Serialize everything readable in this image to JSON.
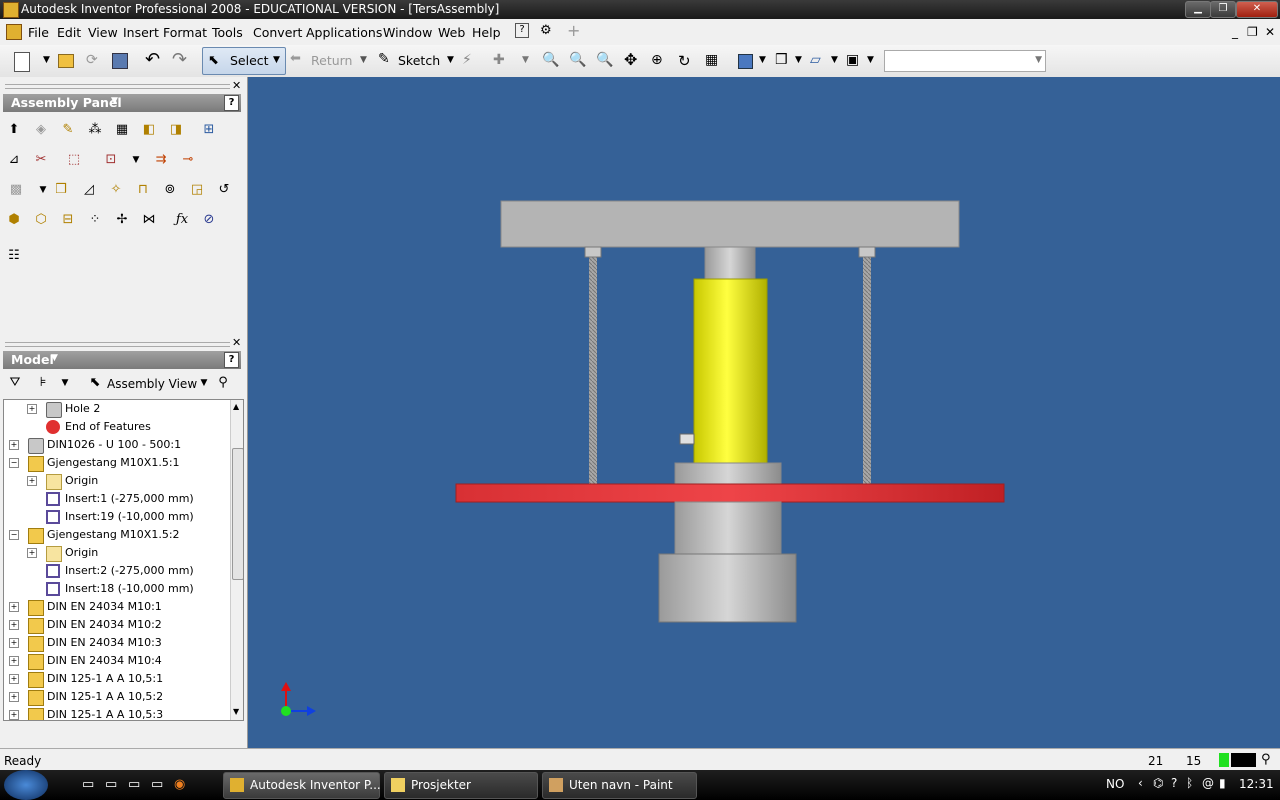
{
  "window": {
    "title": "Autodesk Inventor Professional 2008 - EDUCATIONAL VERSION - [TersAssembly]",
    "min_label": "▁",
    "max_label": "❐",
    "close_label": "✕"
  },
  "menu": {
    "items": [
      "File",
      "Edit",
      "View",
      "Insert",
      "Format",
      "Tools",
      "Convert",
      "Applications",
      "Window",
      "Web",
      "Help"
    ],
    "mdi_min": "_",
    "mdi_restore": "❐",
    "mdi_close": "✕"
  },
  "toolbar": {
    "select_label": "Select",
    "return_label": "Return",
    "sketch_label": "Sketch",
    "combo_value": ""
  },
  "assembly_panel": {
    "title": "Assembly Panel",
    "help": "?"
  },
  "model_panel": {
    "title": "Model",
    "help": "?",
    "view_label": "Assembly View",
    "tree": [
      {
        "label": "Hole 2",
        "icon": "hole",
        "depth": 1,
        "expand": "+"
      },
      {
        "label": "End of Features",
        "icon": "end",
        "depth": 1,
        "expand": ""
      },
      {
        "label": "DIN1026 - U 100 - 500:1",
        "icon": "hole",
        "depth": 0,
        "expand": "+"
      },
      {
        "label": "Gjengestang M10X1.5:1",
        "icon": "asm",
        "depth": 0,
        "expand": "−"
      },
      {
        "label": "Origin",
        "icon": "folder",
        "depth": 1,
        "expand": "+"
      },
      {
        "label": "Insert:1 (-275,000 mm)",
        "icon": "insert",
        "depth": 1,
        "expand": ""
      },
      {
        "label": "Insert:19 (-10,000 mm)",
        "icon": "insert",
        "depth": 1,
        "expand": ""
      },
      {
        "label": "Gjengestang M10X1.5:2",
        "icon": "asm",
        "depth": 0,
        "expand": "−"
      },
      {
        "label": "Origin",
        "icon": "folder",
        "depth": 1,
        "expand": "+"
      },
      {
        "label": "Insert:2 (-275,000 mm)",
        "icon": "insert",
        "depth": 1,
        "expand": ""
      },
      {
        "label": "Insert:18 (-10,000 mm)",
        "icon": "insert",
        "depth": 1,
        "expand": ""
      },
      {
        "label": "DIN EN 24034 M10:1",
        "icon": "asm",
        "depth": 0,
        "expand": "+"
      },
      {
        "label": "DIN EN 24034 M10:2",
        "icon": "asm",
        "depth": 0,
        "expand": "+"
      },
      {
        "label": "DIN EN 24034 M10:3",
        "icon": "asm",
        "depth": 0,
        "expand": "+"
      },
      {
        "label": "DIN EN 24034 M10:4",
        "icon": "asm",
        "depth": 0,
        "expand": "+"
      },
      {
        "label": "DIN 125-1 A A 10,5:1",
        "icon": "asm",
        "depth": 0,
        "expand": "+"
      },
      {
        "label": "DIN 125-1 A A 10,5:2",
        "icon": "asm",
        "depth": 0,
        "expand": "+"
      },
      {
        "label": "DIN 125-1 A A 10,5:3",
        "icon": "asm",
        "depth": 0,
        "expand": "+"
      }
    ]
  },
  "status": {
    "text": "Ready",
    "num1": "21",
    "num2": "15"
  },
  "taskbar": {
    "tasks": [
      "Autodesk Inventor P...",
      "Prosjekter",
      "Uten navn - Paint"
    ],
    "lang": "NO",
    "clock": "12:31"
  },
  "colors": {
    "viewport": "#356197",
    "yellow_cylinder": "#f0f000",
    "red_plate": "#e8383c",
    "steel": "#bfbfbf"
  }
}
